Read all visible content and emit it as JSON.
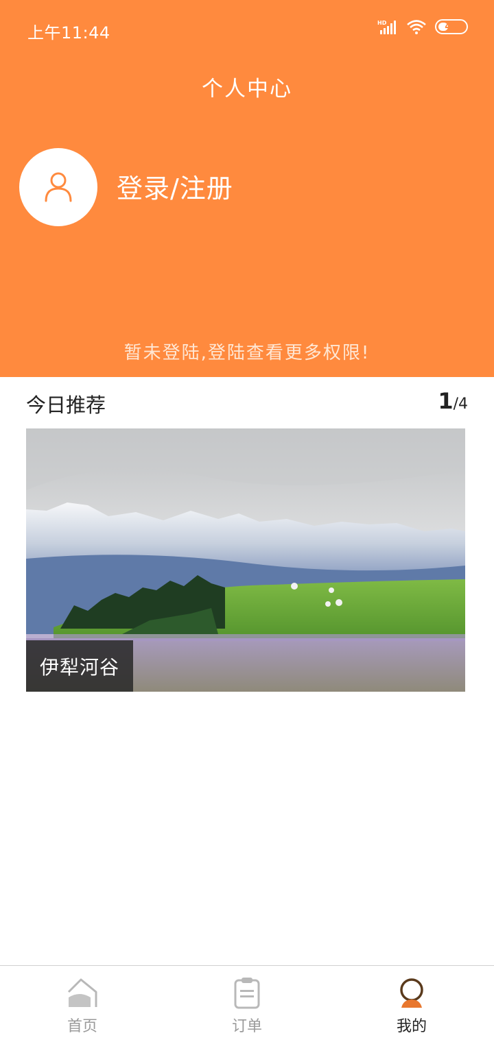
{
  "status_bar": {
    "time": "上午11:44",
    "battery": "45",
    "network": "HD"
  },
  "header": {
    "title": "个人中心",
    "login_label": "登录/注册",
    "hint": "暂未登陆,登陆查看更多权限!",
    "background_color": "#FF8A3E"
  },
  "recommend": {
    "title": "今日推荐",
    "pager": {
      "current": "1",
      "separator": "/",
      "total": "4"
    },
    "banner": {
      "caption": "伊犁河谷"
    }
  },
  "tabbar": {
    "items": [
      {
        "label": "首页",
        "icon": "home-icon",
        "active": false
      },
      {
        "label": "订单",
        "icon": "clipboard-icon",
        "active": false
      },
      {
        "label": "我的",
        "icon": "user-icon",
        "active": true
      }
    ],
    "active_color": "#E8772E",
    "inactive_color": "#9a9a9a"
  }
}
